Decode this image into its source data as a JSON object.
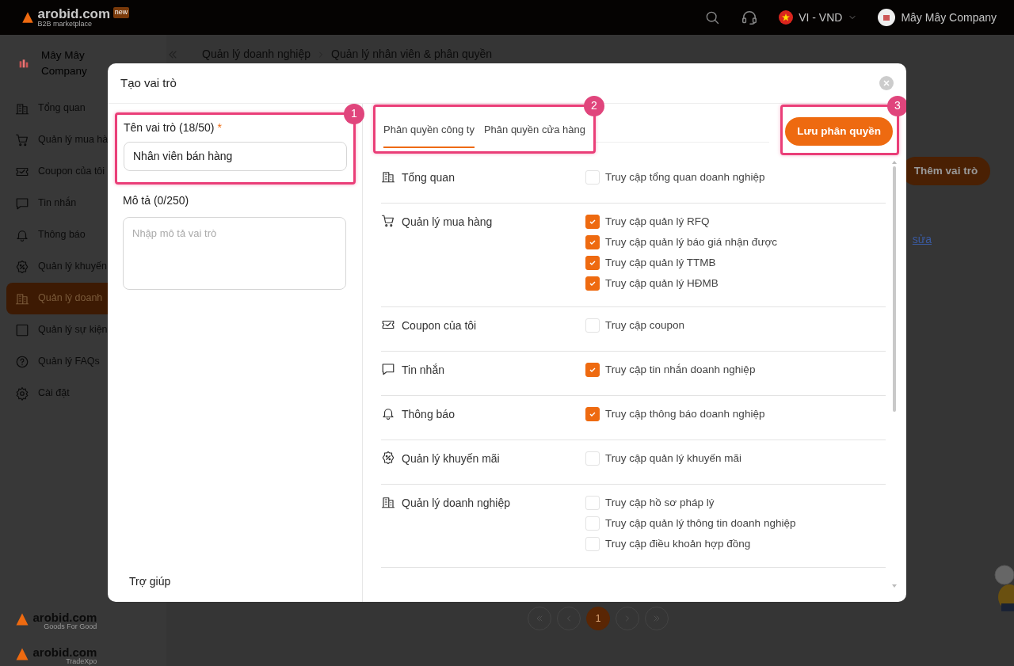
{
  "header": {
    "logo": "arobid.com",
    "logo_badge": "new",
    "tagline": "B2B marketplace",
    "language": "VI - VND",
    "account": "Mây Mây Company"
  },
  "sidebar": {
    "company": "Mây Mây Company",
    "items": [
      {
        "label": "Tổng quan",
        "selected": false
      },
      {
        "label": "Quản lý mua hà",
        "selected": false
      },
      {
        "label": "Coupon của tôi",
        "selected": false
      },
      {
        "label": "Tin nhắn",
        "selected": false
      },
      {
        "label": "Thông báo",
        "selected": false
      },
      {
        "label": "Quản lý khuyến",
        "selected": false
      },
      {
        "label": "Quản lý doanh",
        "selected": true
      },
      {
        "label": "Quản lý sự kiện",
        "selected": false
      },
      {
        "label": "Quản lý FAQs",
        "selected": false
      },
      {
        "label": "Cài đặt",
        "selected": false
      }
    ],
    "logos": [
      {
        "name": "arobid.com",
        "tagline": "Goods For Good"
      },
      {
        "name": "arobid.com",
        "tagline": "TradeXpo"
      }
    ]
  },
  "breadcrumb": [
    "Quản lý doanh nghiệp",
    "Quản lý nhân viên & phân quyền"
  ],
  "page": {
    "add_button": "Thêm vai trò",
    "edit_link": "sửa",
    "pages": [
      {
        "label": "1",
        "selected": true
      }
    ]
  },
  "modal": {
    "title": "Tạo vai trò",
    "name_label": "Tên vai trò (18/50)",
    "required_mark": "*",
    "name_value": "Nhân viên bán hàng",
    "description_label": "Mô tả (0/250)",
    "description_placeholder": "Nhập mô tả vai trò",
    "help": "Trợ giúp",
    "tabs": [
      {
        "label": "Phân quyền công ty",
        "selected": true
      },
      {
        "label": "Phân quyền cửa hàng",
        "selected": false
      }
    ],
    "save_button": "Lưu phân quyền",
    "groups": [
      {
        "name": "Tổng quan",
        "permissions": [
          {
            "label": "Truy cập tổng quan doanh nghiệp",
            "checked": false
          }
        ]
      },
      {
        "name": "Quản lý mua hàng",
        "permissions": [
          {
            "label": "Truy cập quản lý RFQ",
            "checked": true
          },
          {
            "label": "Truy cập quản lý báo giá nhận được",
            "checked": true
          },
          {
            "label": "Truy cập quản lý TTMB",
            "checked": true
          },
          {
            "label": "Truy cập quản lý HĐMB",
            "checked": true
          }
        ]
      },
      {
        "name": "Coupon của tôi",
        "permissions": [
          {
            "label": "Truy cập coupon",
            "checked": false
          }
        ]
      },
      {
        "name": "Tin nhắn",
        "permissions": [
          {
            "label": "Truy cập tin nhắn doanh nghiệp",
            "checked": true
          }
        ]
      },
      {
        "name": "Thông báo",
        "permissions": [
          {
            "label": "Truy cập thông báo doanh nghiệp",
            "checked": true
          }
        ]
      },
      {
        "name": "Quản lý khuyến mãi",
        "permissions": [
          {
            "label": "Truy cập quản lý khuyến mãi",
            "checked": false
          }
        ]
      },
      {
        "name": "Quản lý doanh nghiệp",
        "permissions": [
          {
            "label": "Truy cập hồ sơ pháp lý",
            "checked": false
          },
          {
            "label": "Truy cập quản lý thông tin doanh nghiệp",
            "checked": false
          },
          {
            "label": "Truy cập điều khoản hợp đồng",
            "checked": false
          }
        ]
      }
    ]
  },
  "callouts": [
    "1",
    "2",
    "3"
  ]
}
